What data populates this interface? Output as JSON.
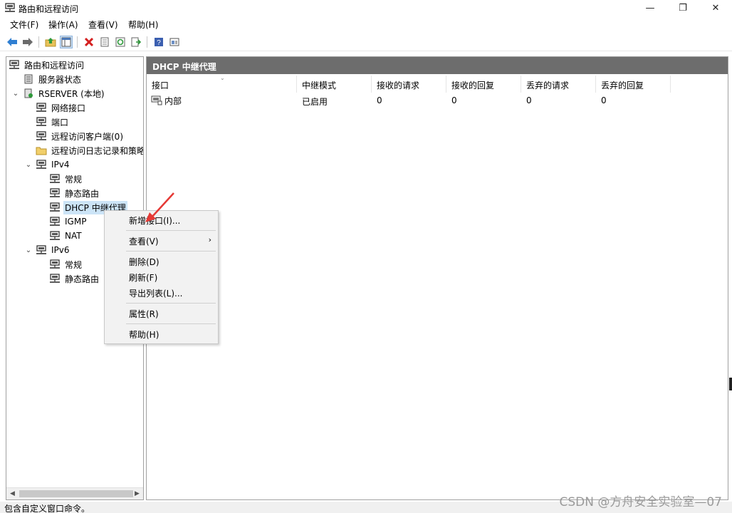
{
  "window": {
    "title": "路由和远程访问",
    "controls": {
      "minimize": "—",
      "maximize": "❐",
      "close": "✕"
    }
  },
  "menubar": {
    "file": "文件(F)",
    "action": "操作(A)",
    "view": "查看(V)",
    "help": "帮助(H)"
  },
  "toolbar": {
    "buttons": [
      "back-arrow-icon",
      "forward-arrow-icon",
      "up-folder-icon",
      "show-hide-tree-icon",
      "delete-icon",
      "properties-icon",
      "refresh-icon",
      "export-list-icon",
      "help-icon",
      "console-icon"
    ]
  },
  "tree": {
    "items": [
      {
        "label": "路由和远程访问",
        "icon": "server-network-icon",
        "level": 0
      },
      {
        "label": "服务器状态",
        "icon": "server-status-icon",
        "level": 1
      },
      {
        "label": "RSERVER (本地)",
        "icon": "server-local-icon",
        "level": 1,
        "expanded": true
      },
      {
        "label": "网络接口",
        "icon": "network-node-icon",
        "level": 2
      },
      {
        "label": "端口",
        "icon": "network-node-icon",
        "level": 2
      },
      {
        "label": "远程访问客户端(0)",
        "icon": "network-node-icon",
        "level": 2
      },
      {
        "label": "远程访问日志记录和策略",
        "icon": "folder-icon",
        "level": 2
      },
      {
        "label": "IPv4",
        "icon": "network-node-icon",
        "level": 2,
        "expanded": true
      },
      {
        "label": "常规",
        "icon": "network-node-icon",
        "level": 3
      },
      {
        "label": "静态路由",
        "icon": "network-node-icon",
        "level": 3
      },
      {
        "label": "DHCP 中继代理",
        "icon": "network-node-icon",
        "level": 3,
        "selected": true
      },
      {
        "label": "IGMP",
        "icon": "network-node-icon",
        "level": 3
      },
      {
        "label": "NAT",
        "icon": "network-node-icon",
        "level": 3
      },
      {
        "label": "IPv6",
        "icon": "network-node-icon",
        "level": 2,
        "expanded": true
      },
      {
        "label": "常规",
        "icon": "network-node-icon",
        "level": 3
      },
      {
        "label": "静态路由",
        "icon": "network-node-icon",
        "level": 3
      }
    ]
  },
  "content": {
    "header": "DHCP 中继代理",
    "columns": [
      "接口",
      "中继模式",
      "接收的请求",
      "接收的回复",
      "丢弃的请求",
      "丢弃的回复"
    ],
    "rows": [
      {
        "interface": "内部",
        "mode": "已启用",
        "recv_requests": "0",
        "recv_replies": "0",
        "dropped_requests": "0",
        "dropped_replies": "0"
      }
    ]
  },
  "context_menu": {
    "new_interface": "新增接口(I)...",
    "view": "查看(V)",
    "delete": "删除(D)",
    "refresh": "刷新(F)",
    "export_list": "导出列表(L)...",
    "properties": "属性(R)",
    "help": "帮助(H)"
  },
  "statusbar": {
    "text": "包含自定义窗口命令。"
  },
  "watermark": "CSDN @方舟安全实验室—07",
  "colors": {
    "content_header_bg": "#6d6d6d",
    "selection": "#cce4f7",
    "annotation_arrow": "#e53935"
  }
}
